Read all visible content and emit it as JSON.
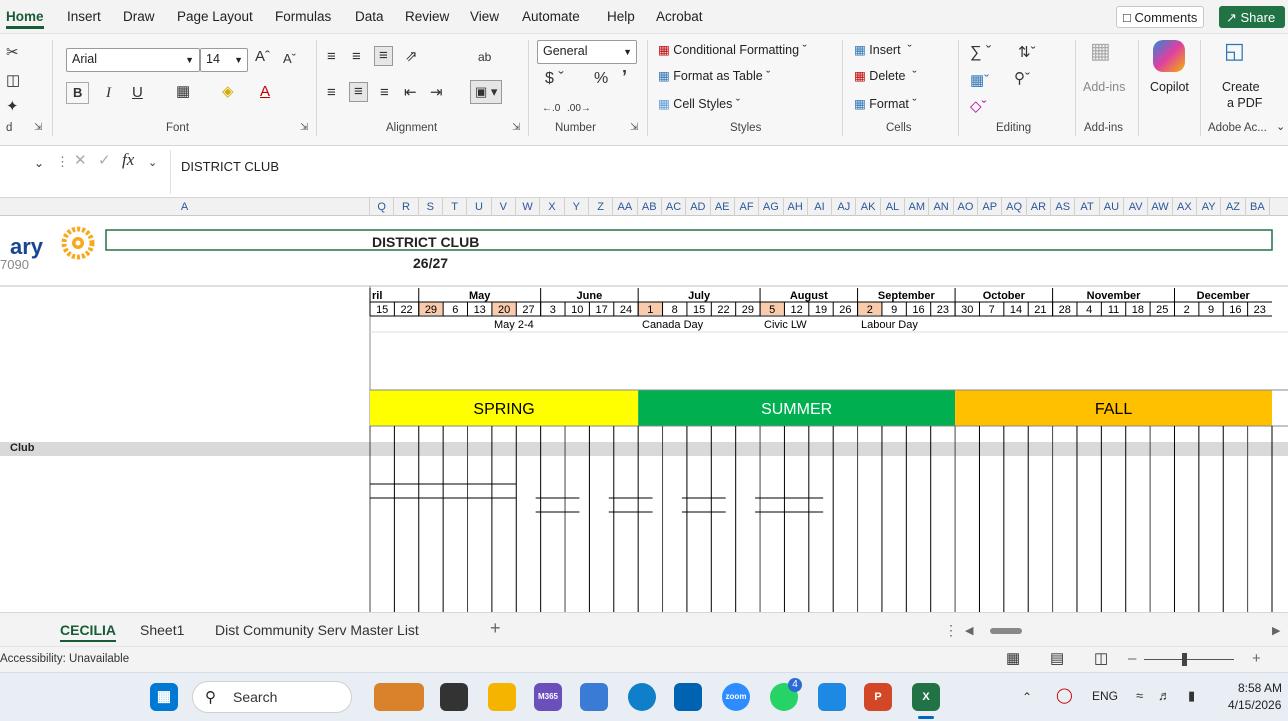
{
  "menu": {
    "items": [
      "Home",
      "Insert",
      "Draw",
      "Page Layout",
      "Formulas",
      "Data",
      "Review",
      "View",
      "Automate",
      "Help",
      "Acrobat"
    ],
    "comments_label": "Comments",
    "share_label": "Share"
  },
  "ribbon": {
    "font_name": "Arial",
    "font_size": "14",
    "number_format": "General",
    "conditional_formatting": "Conditional Formatting",
    "format_as_table": "Format as Table",
    "cell_styles": "Cell Styles",
    "insert": "Insert",
    "delete": "Delete",
    "format": "Format",
    "addins": "Add-ins",
    "copilot": "Copilot",
    "create_pdf_line1": "Create",
    "create_pdf_line2": "a PDF",
    "groups": {
      "clipboard": "d",
      "font": "Font",
      "alignment": "Alignment",
      "number": "Number",
      "styles": "Styles",
      "cells": "Cells",
      "editing": "Editing",
      "addins": "Add-ins",
      "adobe": "Adobe Ac..."
    }
  },
  "formula_bar": {
    "fx": "fx",
    "value": "DISTRICT CLUB"
  },
  "columns": {
    "a_label": "A",
    "list": [
      "Q",
      "R",
      "S",
      "T",
      "U",
      "V",
      "W",
      "X",
      "Y",
      "Z",
      "AA",
      "AB",
      "AC",
      "AD",
      "AE",
      "AF",
      "AG",
      "AH",
      "AI",
      "AJ",
      "AK",
      "AL",
      "AM",
      "AN",
      "AO",
      "AP",
      "AQ",
      "AR",
      "AS",
      "AT",
      "AU",
      "AV",
      "AW",
      "AX",
      "AY",
      "AZ",
      "BA"
    ]
  },
  "sheet": {
    "logo_text": "ary",
    "logo_number": "7090",
    "title": "DISTRICT CLUB",
    "subtitle": "26/27",
    "row_label_club": "Club",
    "months": [
      "ril",
      "May",
      "June",
      "July",
      "August",
      "September",
      "October",
      "November",
      "December"
    ],
    "weeks": [
      "15",
      "22",
      "29",
      "6",
      "13",
      "20",
      "27",
      "3",
      "10",
      "17",
      "24",
      "1",
      "8",
      "15",
      "22",
      "29",
      "5",
      "12",
      "19",
      "26",
      "2",
      "9",
      "16",
      "23",
      "30",
      "7",
      "14",
      "21",
      "28",
      "4",
      "11",
      "18",
      "25",
      "2",
      "9",
      "16",
      "23"
    ],
    "holidays": [
      "May 2-4",
      "Canada Day",
      "Civic LW",
      "Labour Day"
    ],
    "seasons": [
      {
        "label": "SPRING",
        "color": "#ffff00"
      },
      {
        "label": "SUMMER",
        "color": "#00b050"
      },
      {
        "label": "FALL",
        "color": "#ffc000"
      }
    ]
  },
  "sheet_tabs": [
    "CECILIA",
    "Sheet1",
    "Dist Community Serv Master List"
  ],
  "status": {
    "accessibility": "Accessibility: Unavailable"
  },
  "taskbar": {
    "search_placeholder": "Search",
    "lang": "ENG",
    "time": "8:58 AM",
    "date": "4/15/2026",
    "whatsapp_badge": "4"
  }
}
